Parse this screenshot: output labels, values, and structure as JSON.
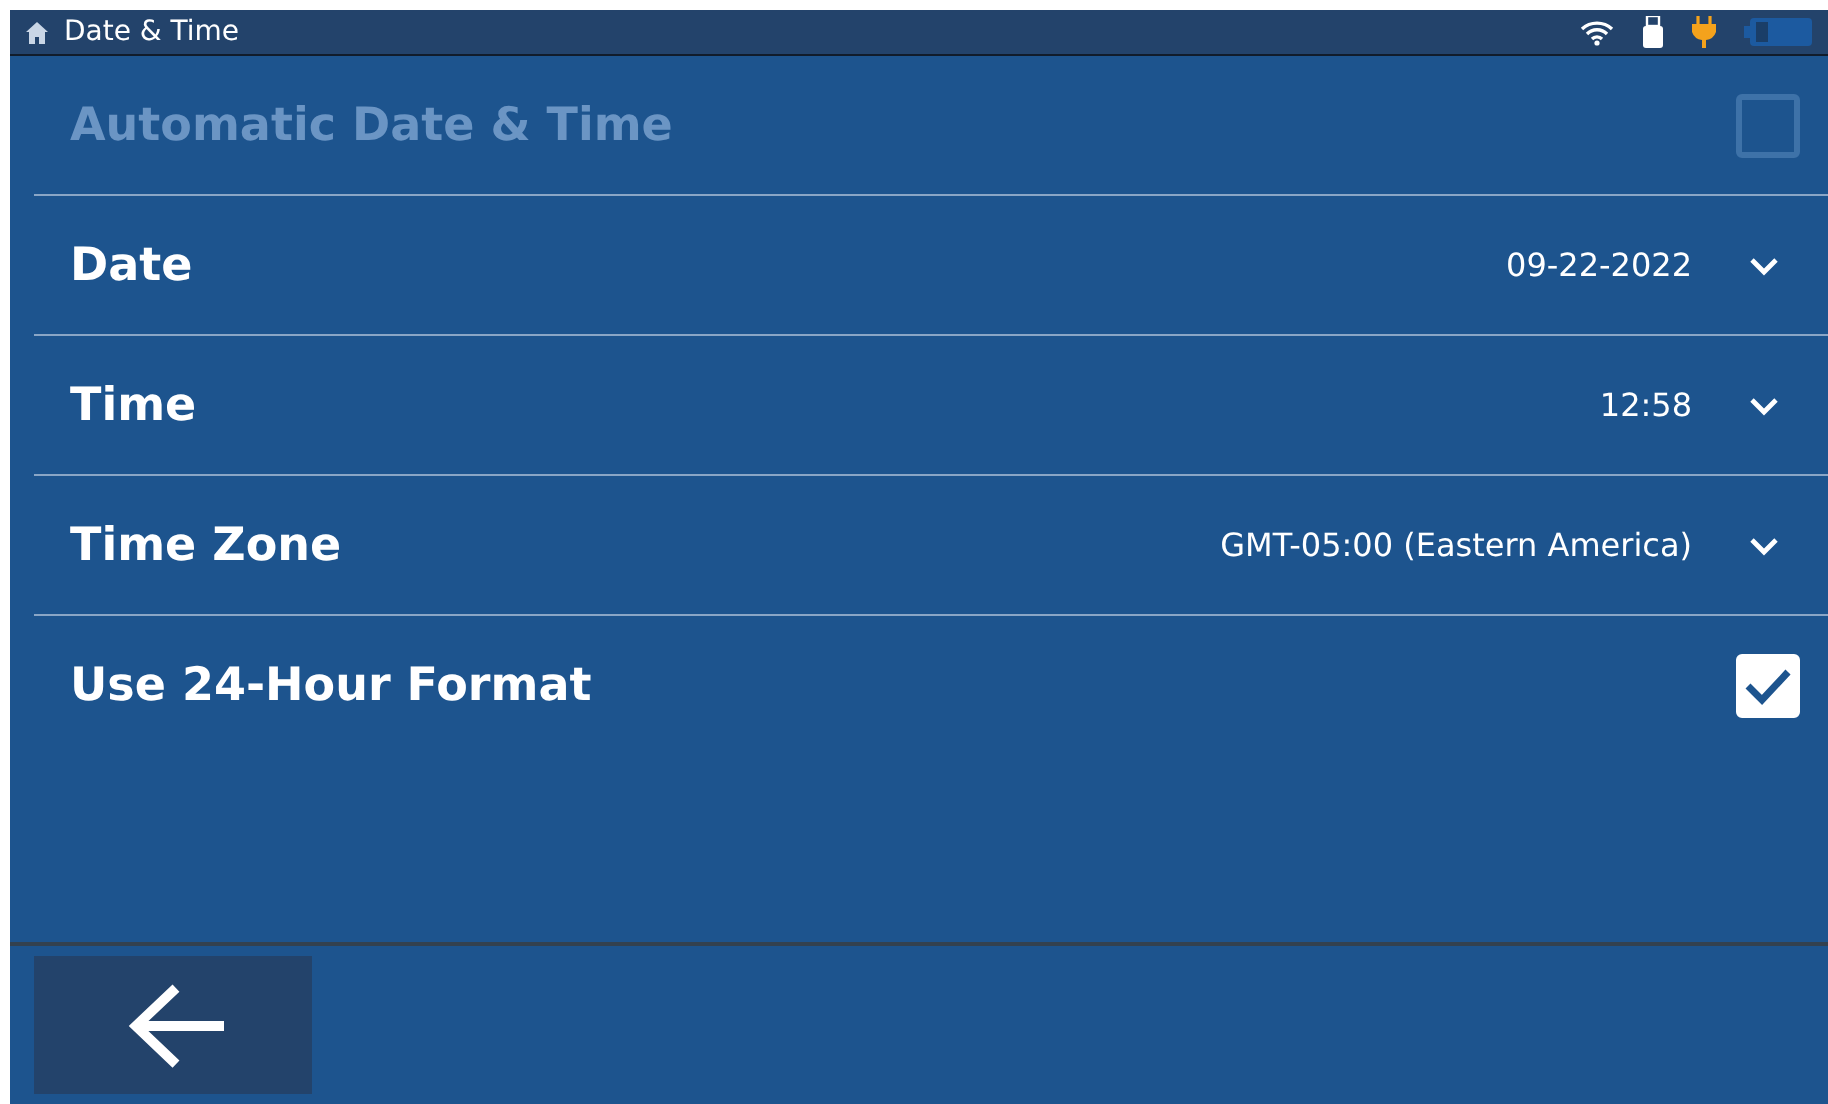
{
  "status_bar": {
    "title": "Date & Time"
  },
  "settings": [
    {
      "kind": "checkbox",
      "label": "Automatic Date & Time",
      "disabled": true,
      "checked": false
    },
    {
      "kind": "dropdown",
      "label": "Date",
      "value": "09-22-2022",
      "disabled": false
    },
    {
      "kind": "dropdown",
      "label": "Time",
      "value": "12:58",
      "disabled": false
    },
    {
      "kind": "dropdown",
      "label": "Time Zone",
      "value": "GMT-05:00 (Eastern America)",
      "disabled": false
    },
    {
      "kind": "checkbox",
      "label": "Use 24-Hour Format",
      "disabled": false,
      "checked": true
    }
  ]
}
